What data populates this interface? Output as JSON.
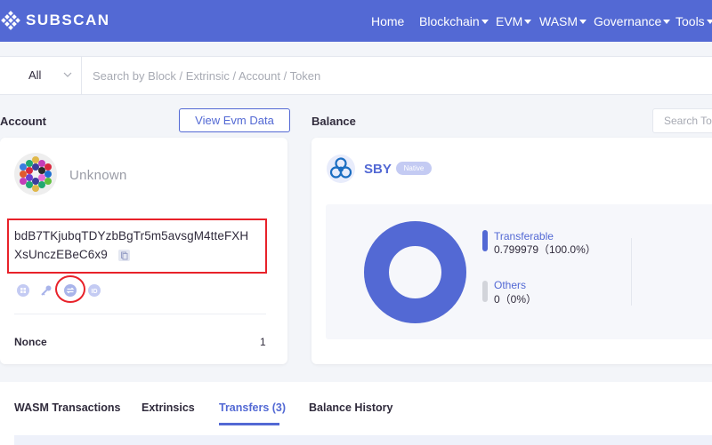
{
  "brand": {
    "name": "SUBSCAN"
  },
  "nav": {
    "items": [
      {
        "label": "Home",
        "has_caret": false
      },
      {
        "label": "Blockchain",
        "has_caret": true
      },
      {
        "label": "EVM",
        "has_caret": true
      },
      {
        "label": "WASM",
        "has_caret": true
      },
      {
        "label": "Governance",
        "has_caret": true
      },
      {
        "label": "Tools",
        "has_caret": true
      }
    ]
  },
  "search": {
    "filter_value": "All",
    "placeholder": "Search by Block / Extrinsic / Account / Token"
  },
  "account": {
    "section_title": "Account",
    "evm_button": "View Evm Data",
    "name": "Unknown",
    "address_line1": "bdB7TKjubqTDYzbBgTr5m5avsgM4tteFXH",
    "address_line2": "XsUnczEBeC6x9",
    "icons": [
      "qr-code-icon",
      "key-icon",
      "convert-icon",
      "id-icon"
    ],
    "nonce_label": "Nonce",
    "nonce_value": "1"
  },
  "balance": {
    "section_title": "Balance",
    "search_placeholder": "Search To",
    "token": {
      "symbol": "SBY",
      "badge": "Native"
    },
    "items": [
      {
        "name": "Transferable",
        "value": "0.799979（100.0%）",
        "color": "#5369d4",
        "fraction": 1.0
      },
      {
        "name": "Others",
        "value": "0（0%）",
        "color": "#d2d4da",
        "fraction": 0.0
      }
    ]
  },
  "tabs": [
    {
      "label": "WASM Transactions",
      "active": false
    },
    {
      "label": "Extrinsics",
      "active": false
    },
    {
      "label": "Transfers (3)",
      "active": true
    },
    {
      "label": "Balance History",
      "active": false
    }
  ],
  "colors": {
    "accent": "#5369d4",
    "highlight": "#e8222a"
  }
}
